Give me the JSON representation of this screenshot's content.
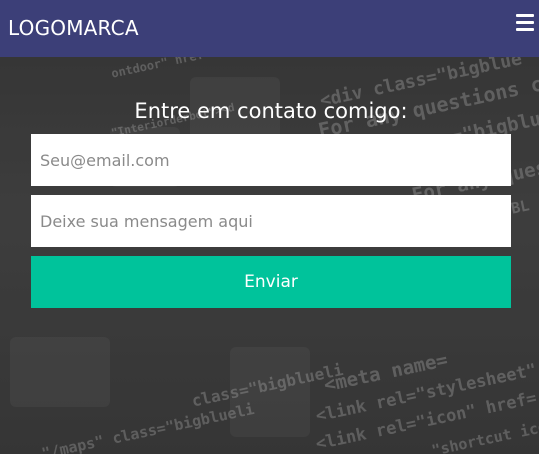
{
  "navbar": {
    "logo": "LOGOMARCA",
    "menu_icon": "hamburger-menu-icon"
  },
  "background": {
    "code_snippets": [
      "<div class=\"bigblue",
      "For any questions call",
      "<span class=\"bigbluet",
      "For any question",
      "ontdoor\" href=\"http",
      "F.html PUBL",
      "\"Interiorderbot\"><d",
      "<meta name=",
      "<link rel=\"stylesheet\" href",
      "<link rel=\"icon\" href=",
      "\"shortcut ico",
      "class=\"bigblueli",
      "\"/maps\" class=\"bigblueli"
    ]
  },
  "contact": {
    "title": "Entre em contato comigo:",
    "email_placeholder": "Seu@email.com",
    "message_placeholder": "Deixe sua mensagem aqui",
    "submit_label": "Enviar"
  },
  "colors": {
    "navbar": "#3c3f78",
    "button": "#00c39b",
    "text": "#ffffff"
  }
}
